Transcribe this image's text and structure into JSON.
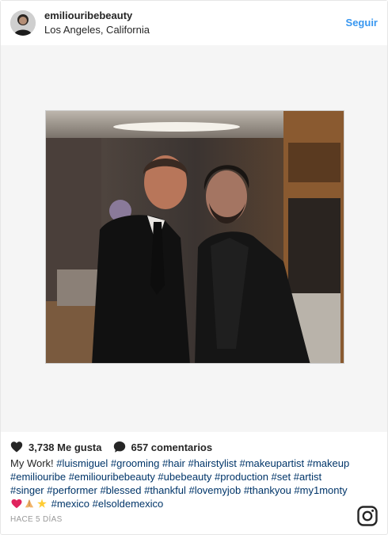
{
  "post": {
    "username": "emiliouribebeauty",
    "location": "Los Angeles, California",
    "follow_label": "Seguir",
    "likes": "3,738 Me gusta",
    "comments": "657 comentarios",
    "caption_lead": "My Work! ",
    "caption_tags_1": "#luismiguel #grooming #hair #hairstylist #makeupartist #makeup #emiliouribe #emiliouribebeauty #ubebeauty #production #set #artist #singer #performer #blessed #thankful #lovemyjob #thankyou #my1monty",
    "caption_tags_2": "#mexico #elsoldemexico",
    "timestamp": "HACE 5 DÍAS"
  },
  "icons": {
    "avatar": "avatar-photo",
    "like": "heart-icon",
    "comment": "comment-bubble-icon",
    "emoji": [
      "red-heart-emoji",
      "praying-hands-emoji",
      "sparkle-star-emoji"
    ],
    "brand": "instagram-logo-icon"
  },
  "colors": {
    "link": "#3897f0",
    "hashtag": "#003569",
    "text": "#262626",
    "muted": "#999999"
  }
}
